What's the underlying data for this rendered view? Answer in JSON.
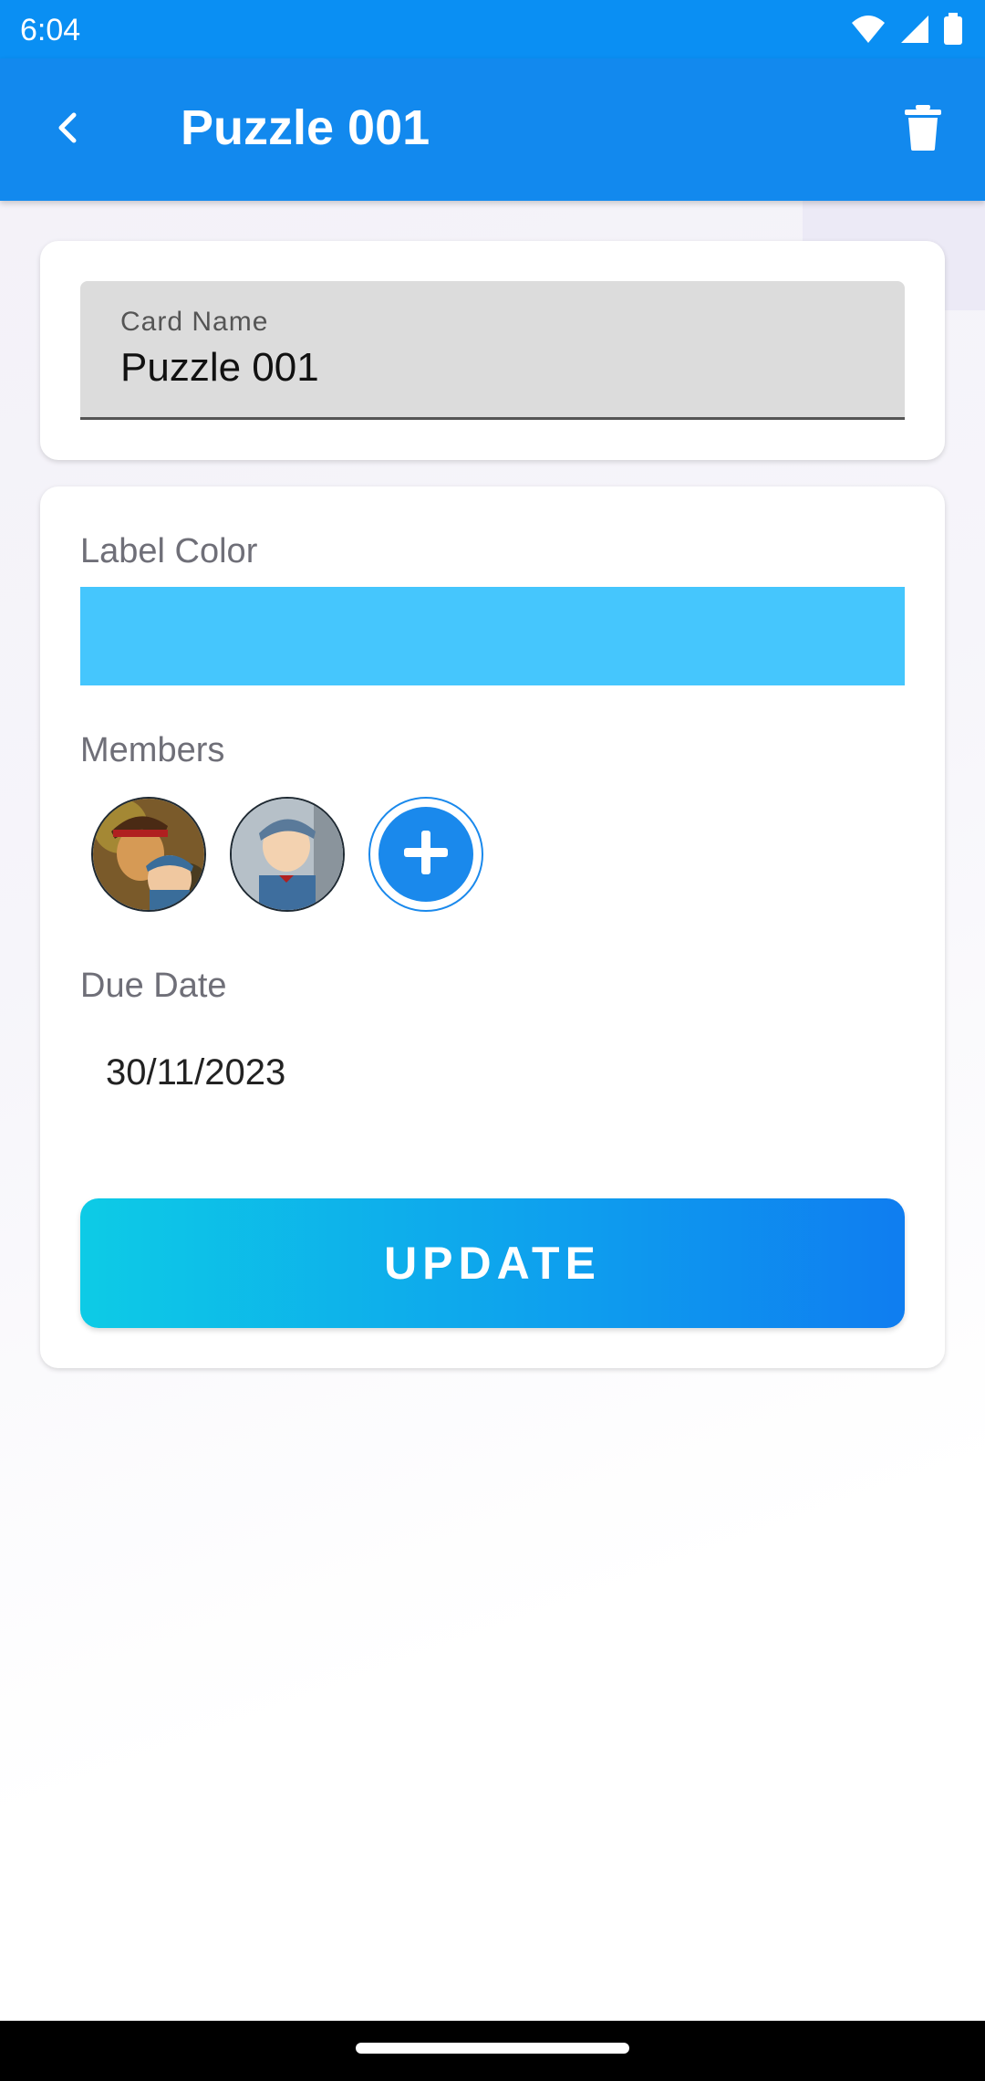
{
  "status_bar": {
    "time": "6:04",
    "icons": [
      "wifi-icon",
      "signal-icon",
      "battery-icon"
    ]
  },
  "app_bar": {
    "title": "Puzzle 001",
    "back_icon": "chevron-left-icon",
    "delete_icon": "trash-icon",
    "background": "#1289ee"
  },
  "card_name_field": {
    "label": "Card Name",
    "value": "Puzzle 001"
  },
  "label_color": {
    "label": "Label Color",
    "color": "#45c6fd"
  },
  "members": {
    "label": "Members",
    "avatars": [
      "member-avatar-1",
      "member-avatar-2"
    ],
    "add_icon": "plus-icon"
  },
  "due_date": {
    "label": "Due Date",
    "value": "30/11/2023"
  },
  "update_button": {
    "label": "UPDATE"
  }
}
